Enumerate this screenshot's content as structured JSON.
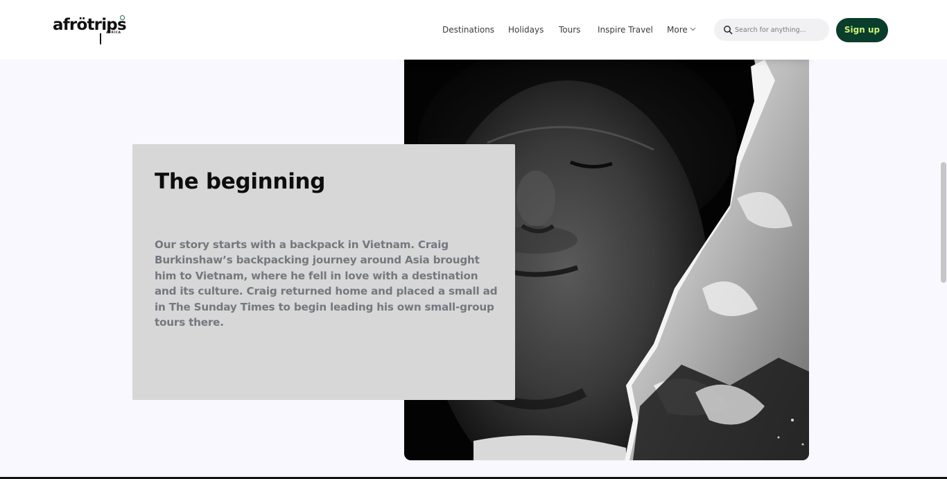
{
  "header": {
    "logo_text": "afrötrips",
    "logo_sub": "AFRICA",
    "nav": [
      {
        "label": "Destinations"
      },
      {
        "label": "Holidays"
      },
      {
        "label": "Tours"
      },
      {
        "label": "Inspire Travel"
      },
      {
        "label": "More"
      }
    ],
    "search": {
      "placeholder": "Search for anything...",
      "icon": "search-icon"
    },
    "signup_label": "Sign up"
  },
  "story": {
    "title": "The beginning",
    "body": "Our story starts with a backpack in Vietnam. Craig Burkinshaw’s backpacking journey around Asia brought him to Vietnam, where he fell in love with a destination and its culture. Craig returned home and placed a small ad in The Sunday Times to begin leading his own small-group tours there."
  },
  "colors": {
    "accent": "#0b3d2c",
    "accent_text": "#c9f27a",
    "page_bg": "#f8f8fe",
    "card_bg": "#d7d7d7"
  }
}
